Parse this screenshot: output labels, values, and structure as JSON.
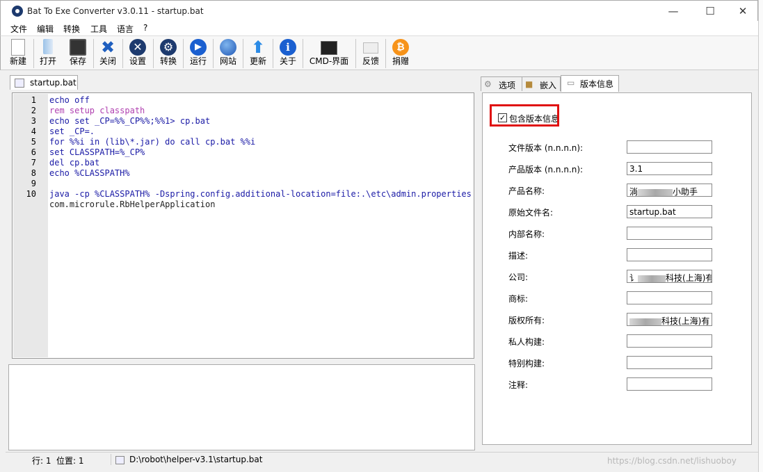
{
  "window": {
    "title": "Bat To Exe Converter v3.0.11 - startup.bat",
    "minimize": "—",
    "maximize": "☐",
    "close": "✕"
  },
  "menu": [
    "文件",
    "编辑",
    "转换",
    "工具",
    "语言",
    "?"
  ],
  "toolbar": [
    {
      "label": "新建",
      "icon": "new-file-icon",
      "color": "#ffffff"
    },
    {
      "label": "打开",
      "icon": "open-icon",
      "color": "#6fa8dc"
    },
    {
      "label": "保存",
      "icon": "save-icon",
      "color": "#333333"
    },
    {
      "label": "关闭",
      "icon": "close-icon",
      "color": "#1f5fbf"
    },
    {
      "label": "设置",
      "icon": "settings-icon",
      "color": "#1d3a6e"
    },
    {
      "label": "转换",
      "icon": "convert-icon",
      "color": "#1d3a6e"
    },
    {
      "label": "运行",
      "icon": "run-icon",
      "color": "#1a5fd0"
    },
    {
      "label": "网站",
      "icon": "globe-icon",
      "color": "#2a6fcf"
    },
    {
      "label": "更新",
      "icon": "update-icon",
      "color": "#2b8be6"
    },
    {
      "label": "关于",
      "icon": "info-icon",
      "color": "#1a5fd0"
    },
    {
      "label": "CMD-界面",
      "icon": "terminal-icon",
      "color": "#222222"
    },
    {
      "label": "反馈",
      "icon": "mail-icon",
      "color": "#d8d8d8"
    },
    {
      "label": "捐赠",
      "icon": "bitcoin-icon",
      "color": "#f7931a"
    }
  ],
  "editor": {
    "tab_label": "startup.bat",
    "lines": [
      {
        "no": "1",
        "text": "echo off"
      },
      {
        "no": "2",
        "text": "rem setup classpath"
      },
      {
        "no": "3",
        "text": "echo set _CP=%%_CP%%;%%1> cp.bat"
      },
      {
        "no": "4",
        "text": "set _CP=."
      },
      {
        "no": "5",
        "text": "for %%i in (lib\\*.jar) do call cp.bat %%i"
      },
      {
        "no": "6",
        "text": "set CLASSPATH=%_CP%"
      },
      {
        "no": "7",
        "text": "del cp.bat"
      },
      {
        "no": "8",
        "text": "echo %CLASSPATH%"
      },
      {
        "no": "9",
        "text": ""
      },
      {
        "no": "10",
        "text": "java -cp %CLASSPATH% -Dspring.config.additional-location=file:.\\etc\\admin.properties"
      },
      {
        "no": "",
        "text": "com.microrule.RbHelperApplication"
      }
    ]
  },
  "right_tabs": [
    "选项",
    "嵌入",
    "版本信息"
  ],
  "version_info": {
    "include_label": "包含版本信息",
    "include_checked": true,
    "fields": [
      {
        "label": "文件版本 (n.n.n.n):",
        "value": ""
      },
      {
        "label": "产品版本 (n.n.n.n):",
        "value": "3.1"
      },
      {
        "label": "产品名称:",
        "value": "小助手",
        "prefix": "淌"
      },
      {
        "label": "原始文件名:",
        "value": "startup.bat"
      },
      {
        "label": "内部名称:",
        "value": ""
      },
      {
        "label": "描述:",
        "value": ""
      },
      {
        "label": "公司:",
        "value": "科技(上海)有",
        "prefix": "讠"
      },
      {
        "label": "商标:",
        "value": ""
      },
      {
        "label": "版权所有:",
        "value": "科技(上海)有"
      },
      {
        "label": "私人构建:",
        "value": ""
      },
      {
        "label": "特别构建:",
        "value": ""
      },
      {
        "label": "注释:",
        "value": ""
      }
    ]
  },
  "status": {
    "line": "行: 1",
    "position": "位置: 1",
    "path": "D:\\robot\\helper-v3.1\\startup.bat"
  },
  "watermark": "https://blog.csdn.net/lishuoboy",
  "colors": {
    "highlight": "#e01010",
    "accent": "#1a5fd0"
  }
}
